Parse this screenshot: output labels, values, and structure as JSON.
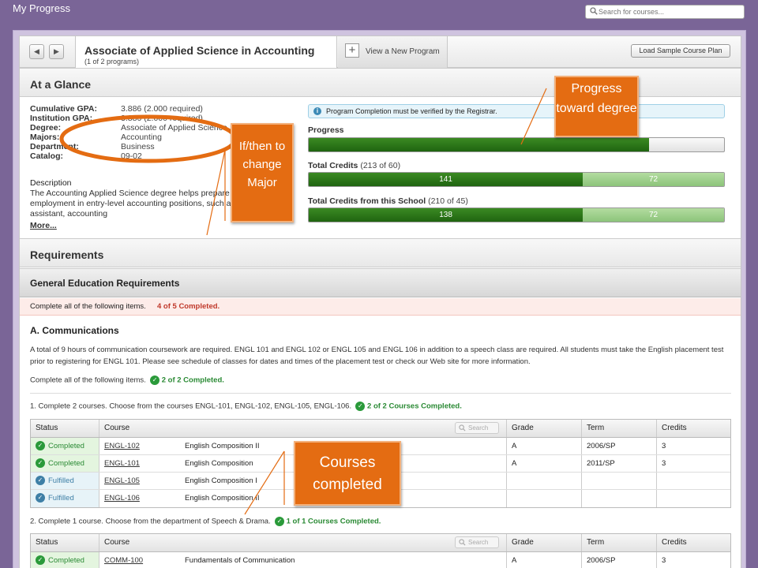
{
  "app": {
    "title": "My Progress"
  },
  "search": {
    "placeholder": "Search for courses..."
  },
  "program": {
    "title": "Associate of Applied Science in Accounting",
    "subtitle": "(1 of 2 programs)",
    "view_new": "View a New Program",
    "load_sample": "Load Sample Course Plan",
    "prev_icon": "chevron-left-icon",
    "next_icon": "chevron-right-icon"
  },
  "glance": {
    "heading": "At a Glance",
    "fields": [
      {
        "label": "Cumulative GPA:",
        "value": "3.886 (2.000 required)"
      },
      {
        "label": "Institution GPA:",
        "value": "3.886 (2.000 required)"
      },
      {
        "label": "Degree:",
        "value": "Associate of Applied Science"
      },
      {
        "label": "Majors:",
        "value": "Accounting"
      },
      {
        "label": "Department:",
        "value": "Business"
      },
      {
        "label": "Catalog:",
        "value": "09-02"
      }
    ],
    "description_label": "Description",
    "description": "The Accounting Applied Science degree helps prepare the student for employment in entry-level accounting positions, such as accounting assistant, accounting",
    "more": "More...",
    "info": "Program Completion must be verified by the Registrar.",
    "progress_label": "Progress",
    "progress_fraction": 0.82,
    "total_credits_label": "Total Credits",
    "total_credits_note": "(213 of 60)",
    "total_credits_done": "141",
    "total_credits_other": "72",
    "school_credits_label": "Total Credits from this School",
    "school_credits_note": "(210 of 45)",
    "school_credits_done": "138",
    "school_credits_other": "72",
    "bar_split_fraction": 0.66
  },
  "requirements": {
    "heading": "Requirements",
    "group_title": "General Education Requirements",
    "group_instruction": "Complete all of the following items.",
    "group_status": "4 of 5 Completed.",
    "section_title": "A. Communications",
    "section_desc": "A total of 9 hours of communication coursework are required. ENGL 101 and ENGL 102 or ENGL 105 and ENGL 106 in addition to a speech class are required. All students must take the English placement test prior to registering for ENGL 101. Please see schedule of classes for dates and times of the placement test or check our Web site for more information.",
    "section_instruction": "Complete all of the following items.",
    "section_status": "2 of 2 Completed.",
    "item1_text": "1. Complete 2 courses. Choose from the courses ENGL-101, ENGL-102, ENGL-105, ENGL-106.",
    "item1_status": "2 of 2 Courses Completed.",
    "item2_text": "2. Complete 1 course. Choose from the department of Speech & Drama.",
    "item2_status": "1 of 1 Courses Completed.",
    "columns": {
      "status": "Status",
      "course": "Course",
      "search": "Search",
      "grade": "Grade",
      "term": "Term",
      "credits": "Credits"
    },
    "table1": [
      {
        "status": "Completed",
        "code": "ENGL-102",
        "name": "English Composition II",
        "grade": "A",
        "term": "2006/SP",
        "credits": "3"
      },
      {
        "status": "Completed",
        "code": "ENGL-101",
        "name": "English Composition",
        "grade": "A",
        "term": "2011/SP",
        "credits": "3"
      },
      {
        "status": "Fulfilled",
        "code": "ENGL-105",
        "name": "English Composition I",
        "grade": "",
        "term": "",
        "credits": ""
      },
      {
        "status": "Fulfilled",
        "code": "ENGL-106",
        "name": "English Composition II",
        "grade": "",
        "term": "",
        "credits": ""
      }
    ],
    "table2": [
      {
        "status": "Completed",
        "code": "COMM-100",
        "name": "Fundamentals of Communication",
        "grade": "A",
        "term": "2006/SP",
        "credits": "3"
      }
    ]
  },
  "annotations": {
    "progress_callout": "Progress toward degree",
    "ifthen_callout": "If/then to change Major",
    "courses_callout": "Courses completed",
    "color": "#e46c12"
  }
}
